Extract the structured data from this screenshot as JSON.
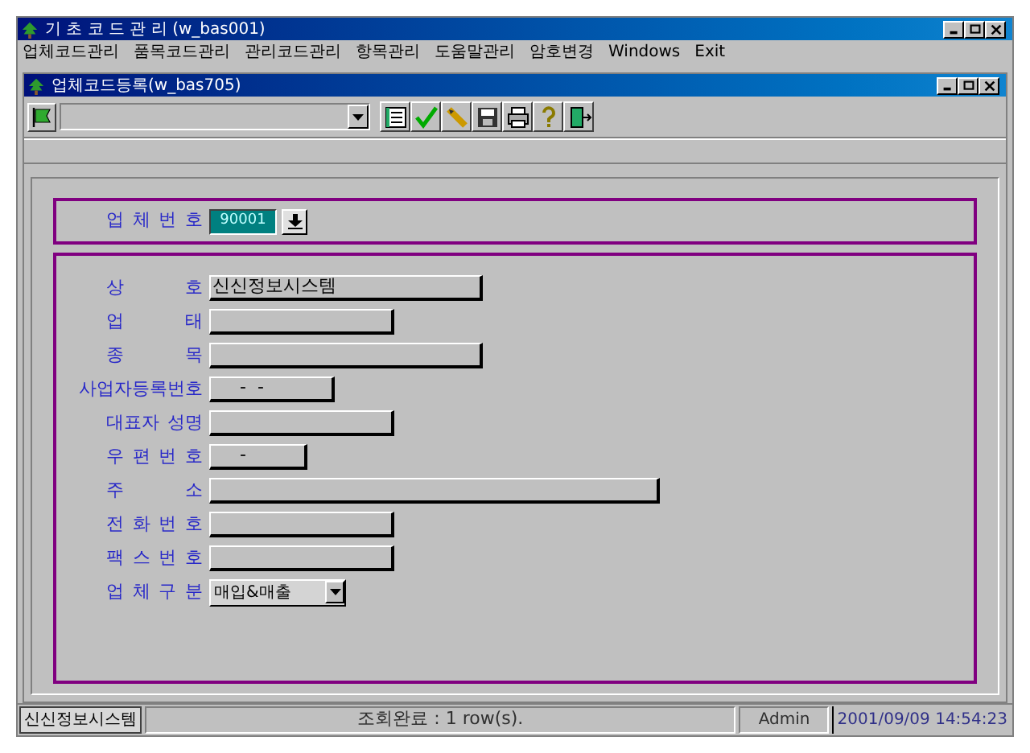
{
  "app_window": {
    "title": "기 초 코 드 관 리 (w_bas001)"
  },
  "menu": [
    "업체코드관리",
    "품목코드관리",
    "관리코드관리",
    "항목관리",
    "도움말관리",
    "암호변경",
    "Windows",
    "Exit"
  ],
  "child_window": {
    "title": "업체코드등록(w_bas705)"
  },
  "vendor_number": {
    "label": "업 체 번 호",
    "value": "90001"
  },
  "fields": [
    {
      "label": "상 호",
      "value": "신신정보시스템",
      "kind": "text"
    },
    {
      "label": "업 태",
      "kind": "text"
    },
    {
      "label": "종 목",
      "kind": "text"
    },
    {
      "label": "사업자등록번호",
      "value": "-  -",
      "kind": "text"
    },
    {
      "label": "대표자 성명",
      "kind": "text"
    },
    {
      "label": "우 편 번 호",
      "value": "-",
      "kind": "text"
    },
    {
      "label": "주 소",
      "kind": "text"
    },
    {
      "label": "전 화 번 호",
      "kind": "text"
    },
    {
      "label": "팩 스 번 호",
      "kind": "text"
    },
    {
      "label": "업 체 구 분",
      "value": "매입&매출",
      "kind": "combo"
    }
  ],
  "status_bar": {
    "company": "신신정보시스템",
    "message": "조회완료 : 1 row(s).",
    "user": "Admin",
    "datetime": "2001/09/09 14:54:23"
  }
}
